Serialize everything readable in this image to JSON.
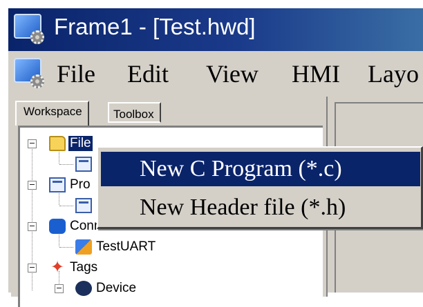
{
  "window": {
    "title": "Frame1 - [Test.hwd]"
  },
  "menubar": {
    "items": [
      "File",
      "Edit",
      "View",
      "HMI",
      "Layo"
    ]
  },
  "workspace": {
    "tabs": [
      {
        "label": "Workspace",
        "active": true
      },
      {
        "label": "Toolbox",
        "active": false
      }
    ],
    "tree": [
      {
        "label": "File",
        "icon": "folder-icon",
        "selected": true
      },
      {
        "label": "",
        "icon": "calendar-file-icon"
      },
      {
        "label": "Pro",
        "icon": "project-file-icon"
      },
      {
        "label": "",
        "icon": "source-file-icon"
      },
      {
        "label": "Connection",
        "icon": "connection-icon"
      },
      {
        "label": "TestUART",
        "icon": "uart-icon"
      },
      {
        "label": "Tags",
        "icon": "tags-icon"
      },
      {
        "label": "Device",
        "icon": "device-icon"
      }
    ]
  },
  "context_menu": {
    "items": [
      {
        "label": "New C Program (*.c)",
        "mnemonic": "N",
        "highlighted": true
      },
      {
        "label": "New Header file (*.h)",
        "mnemonic": "e",
        "highlighted": false
      }
    ]
  },
  "colors": {
    "titlebar": "#0a246a",
    "selection": "#0a246a",
    "face": "#d4d0c8"
  }
}
